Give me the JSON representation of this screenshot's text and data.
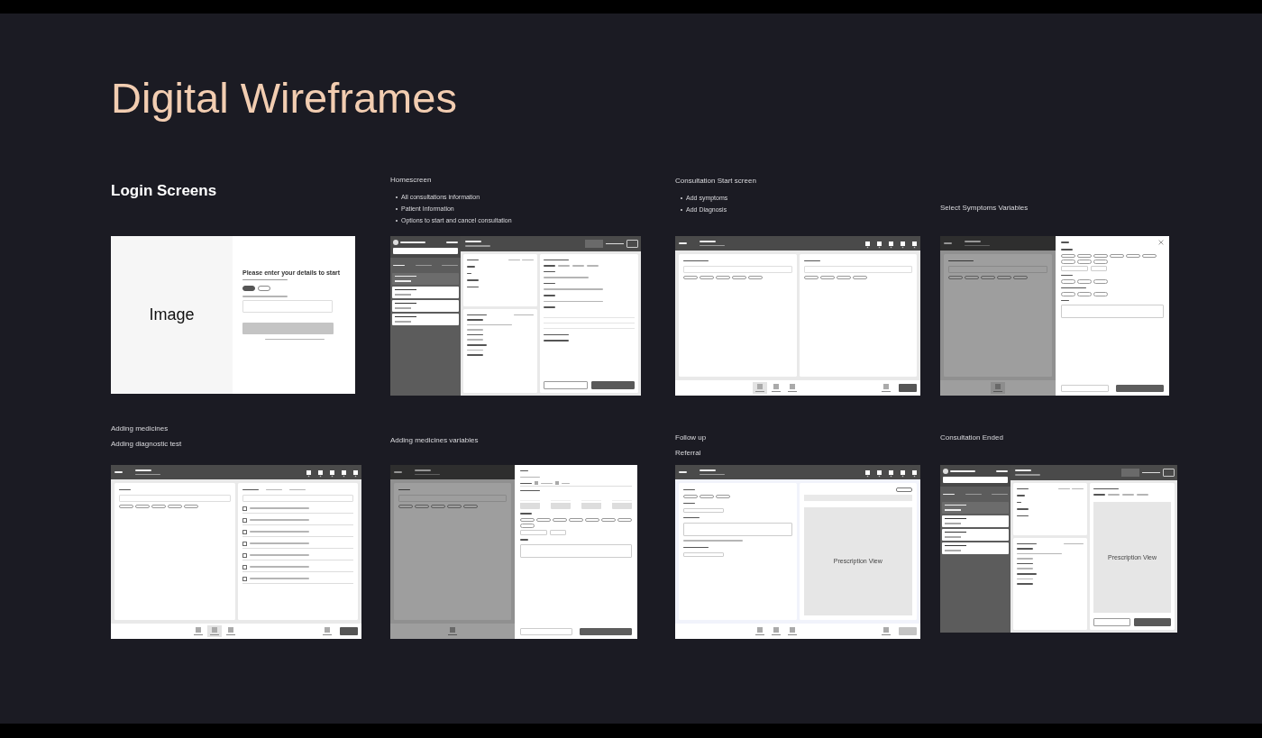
{
  "title": "Digital Wireframes",
  "screens": [
    {
      "kind": "login",
      "heading": "Login Screens",
      "image_label": "Image",
      "form_heading": "Please enter your details to start",
      "methods": [
        {
          "selected": true
        },
        {
          "selected": false
        }
      ],
      "button": {
        "disabled": true
      }
    },
    {
      "kind": "home",
      "lines": [
        "Homescreen"
      ],
      "bullets": [
        "All consultations information",
        "Patient Information",
        "Options to start and cancel consultation"
      ],
      "patients": [
        {
          "selected": true
        },
        {
          "selected": false
        },
        {
          "selected": false
        },
        {
          "selected": false
        }
      ]
    },
    {
      "kind": "consult",
      "lines": [
        "Consultation Start screen"
      ],
      "bullets": [
        "Add symptoms",
        "Add Diagnosis"
      ],
      "nav": [
        {
          "selected": true
        },
        {
          "selected": false
        },
        {
          "selected": false
        }
      ]
    },
    {
      "kind": "symptoms",
      "lines": [
        "Select Symptoms Variables"
      ],
      "nav": [
        {
          "selected": true
        }
      ]
    },
    {
      "kind": "medicines",
      "lines": [
        "Adding medicines",
        "Adding diagnostic test"
      ],
      "nav": [
        {
          "selected": false
        },
        {
          "selected": true
        },
        {
          "selected": false
        }
      ],
      "tests": [
        {
          "checked": false
        },
        {
          "checked": false
        },
        {
          "checked": false
        },
        {
          "checked": false
        },
        {
          "checked": false
        },
        {
          "checked": false
        },
        {
          "checked": false
        }
      ]
    },
    {
      "kind": "medicine_vars",
      "lines": [
        "Adding medicines variables"
      ],
      "nav": [
        {
          "selected": false
        }
      ]
    },
    {
      "kind": "followup",
      "lines": [
        "Follow up",
        "Referral"
      ],
      "nav": [
        {
          "selected": false
        },
        {
          "selected": false
        },
        {
          "selected": false
        }
      ],
      "view": "Prescription View"
    },
    {
      "kind": "ended",
      "lines": [
        "Consultation Ended"
      ],
      "patients": [
        {
          "selected": true
        },
        {
          "selected": false
        },
        {
          "selected": false
        },
        {
          "selected": false
        }
      ],
      "view": "Prescription View"
    }
  ]
}
